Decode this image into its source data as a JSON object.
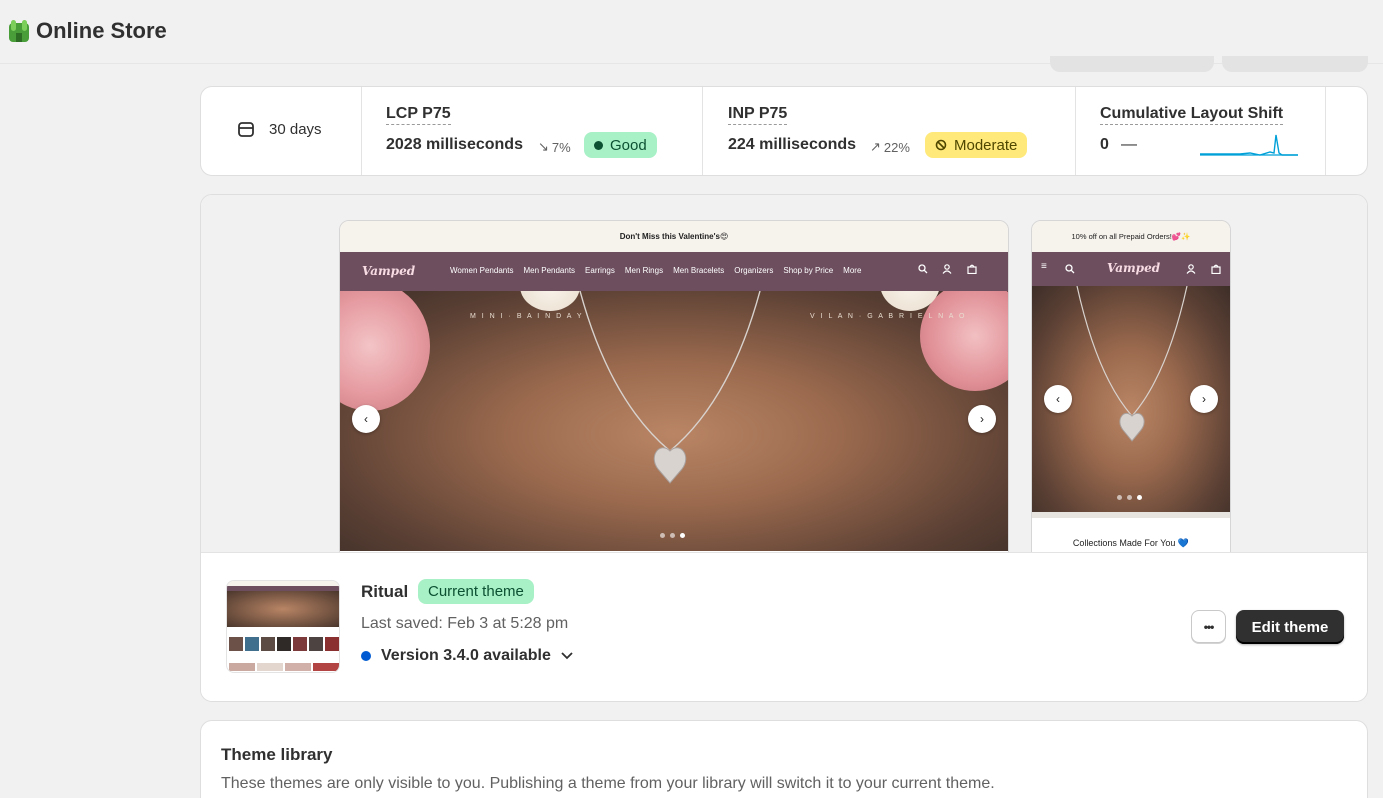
{
  "app": {
    "title": "Online Store"
  },
  "metrics": {
    "period": "30 days",
    "lcp": {
      "label": "LCP P75",
      "value": "2028 milliseconds",
      "delta": "7%",
      "status": "Good"
    },
    "inp": {
      "label": "INP P75",
      "value": "224 milliseconds",
      "delta": "22%",
      "status": "Moderate"
    },
    "cls": {
      "label": "Cumulative Layout Shift",
      "value": "0",
      "dash": "—"
    }
  },
  "preview": {
    "desktop": {
      "announcement": "Don't Miss this Valentine's😍",
      "logo": "Vamped",
      "nav": [
        "Women Pendants",
        "Men Pendants",
        "Earrings",
        "Men Rings",
        "Men Bracelets",
        "Organizers",
        "Shop by Price",
        "More"
      ],
      "left_caption": "M I N I · B A I N D A Y",
      "right_caption": "V I L A N · G A B R I E L N A O"
    },
    "mobile": {
      "announcement": "10% off on all Prepaid Orders!💕✨",
      "logo": "Vamped",
      "section_title": "Collections Made For You 💙"
    }
  },
  "theme": {
    "name": "Ritual",
    "badge": "Current theme",
    "last_saved": "Last saved: Feb 3 at 5:28 pm",
    "version": "Version 3.4.0 available",
    "more_label": "•••",
    "edit_label": "Edit theme"
  },
  "library": {
    "title": "Theme library",
    "description": "These themes are only visible to you. Publishing a theme from your library will switch it to your current theme."
  },
  "colors": {
    "accent": "#303030",
    "good_bg": "#a8f0c6",
    "moderate_bg": "#ffe97a",
    "store_nav": "#6c4e5e",
    "version_dot": "#005bd3",
    "sparkline": "#00a0d8"
  }
}
